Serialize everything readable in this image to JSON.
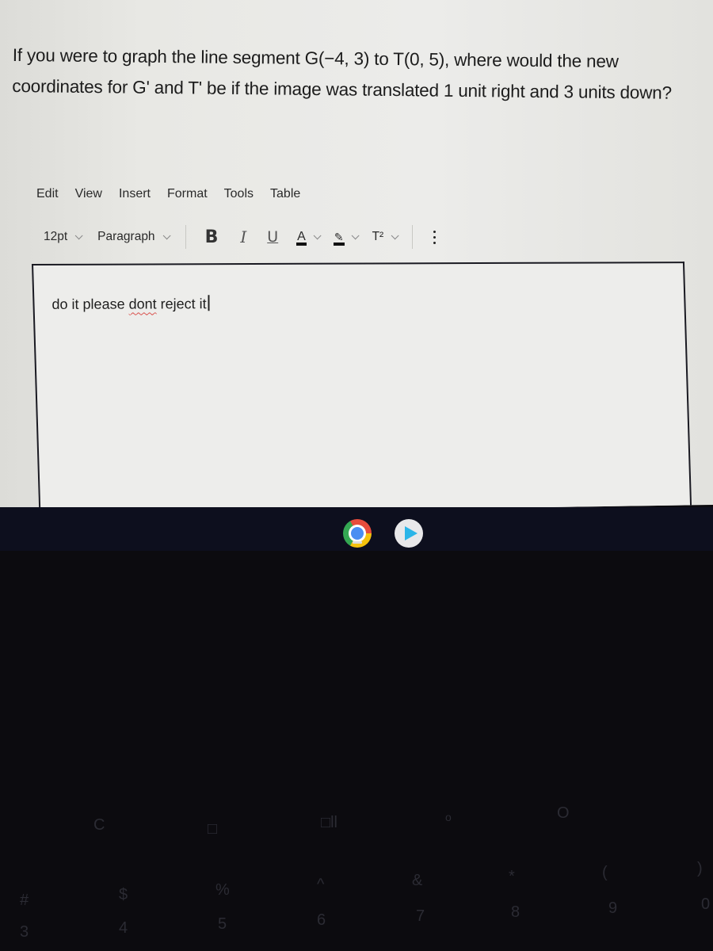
{
  "question": {
    "text": "If you were to graph the line segment G(−4, 3) to T(0, 5), where would the new coordinates for G' and T' be if the image was translated 1 unit right and 3 units down?"
  },
  "menubar": {
    "items": [
      "Edit",
      "View",
      "Insert",
      "Format",
      "Tools",
      "Table"
    ]
  },
  "toolbar": {
    "font_size": "12pt",
    "block_format": "Paragraph",
    "bold_label": "B",
    "italic_label": "I",
    "underline_label": "U",
    "text_color_label": "A",
    "highlight_label": "✎",
    "superscript_label": "T²",
    "more_label": "more options"
  },
  "editor": {
    "text_before": "do it please ",
    "misspelled_word": "dont",
    "text_after": " reject it"
  },
  "shelf": {
    "apps": [
      "chrome-icon",
      "play-store-icon"
    ]
  },
  "keyboard": {
    "visible_keys": [
      "C",
      "□",
      "□ll",
      "o",
      "O",
      "#",
      "$",
      "%",
      "^",
      "&",
      "*",
      "(",
      ")",
      "3",
      "4",
      "5",
      "6",
      "7",
      "8",
      "9",
      "0"
    ]
  }
}
